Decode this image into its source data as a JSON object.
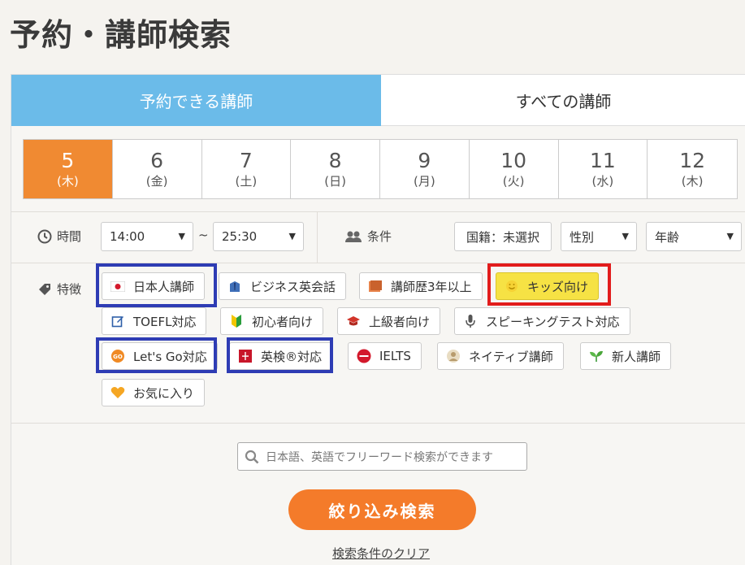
{
  "page_title": "予約・講師検索",
  "tabs": [
    {
      "label": "予約できる講師",
      "active": true
    },
    {
      "label": "すべての講師",
      "active": false
    }
  ],
  "dates": [
    {
      "num": "5",
      "dow": "(木)",
      "selected": true
    },
    {
      "num": "6",
      "dow": "(金)"
    },
    {
      "num": "7",
      "dow": "(土)"
    },
    {
      "num": "8",
      "dow": "(日)"
    },
    {
      "num": "9",
      "dow": "(月)"
    },
    {
      "num": "10",
      "dow": "(火)"
    },
    {
      "num": "11",
      "dow": "(水)"
    },
    {
      "num": "12",
      "dow": "(木)"
    }
  ],
  "time": {
    "label": "時間",
    "from": "14:00",
    "tilde": "~",
    "to": "25:30"
  },
  "conditions": {
    "label": "条件",
    "nationality": "国籍：未選択",
    "gender": "性別",
    "age": "年齢"
  },
  "features": {
    "label": "特徴",
    "tags": [
      {
        "label": "日本人講師",
        "icon": "japan-flag-icon"
      },
      {
        "label": "ビジネス英会話",
        "icon": "business-suit-icon"
      },
      {
        "label": "講師歴3年以上",
        "icon": "book-icon"
      },
      {
        "label": "キッズ向け",
        "icon": "smiley-icon"
      },
      {
        "label": "TOEFL対応",
        "icon": "pen-edit-icon"
      },
      {
        "label": "初心者向け",
        "icon": "beginner-mark-icon"
      },
      {
        "label": "上級者向け",
        "icon": "graduation-cap-icon"
      },
      {
        "label": "スピーキングテスト対応",
        "icon": "microphone-icon"
      },
      {
        "label": "Let's Go対応",
        "icon": "lets-go-icon"
      },
      {
        "label": "英検®対応",
        "icon": "eiken-icon"
      },
      {
        "label": "IELTS",
        "icon": "ielts-icon"
      },
      {
        "label": "ネイティブ講師",
        "icon": "native-speaker-icon"
      },
      {
        "label": "新人講師",
        "icon": "sprout-icon"
      },
      {
        "label": "お気に入り",
        "icon": "heart-icon"
      }
    ]
  },
  "search": {
    "placeholder": "日本語、英語でフリーワード検索ができます",
    "button": "絞り込み検索",
    "clear": "検索条件のクリア"
  },
  "colors": {
    "tab_active": "#6bbbe9",
    "date_selected": "#f08a32",
    "search_button": "#f47b2a",
    "kids_tag": "#f6e244",
    "highlight_blue": "#2e3cb4",
    "highlight_red": "#e21c1c"
  }
}
